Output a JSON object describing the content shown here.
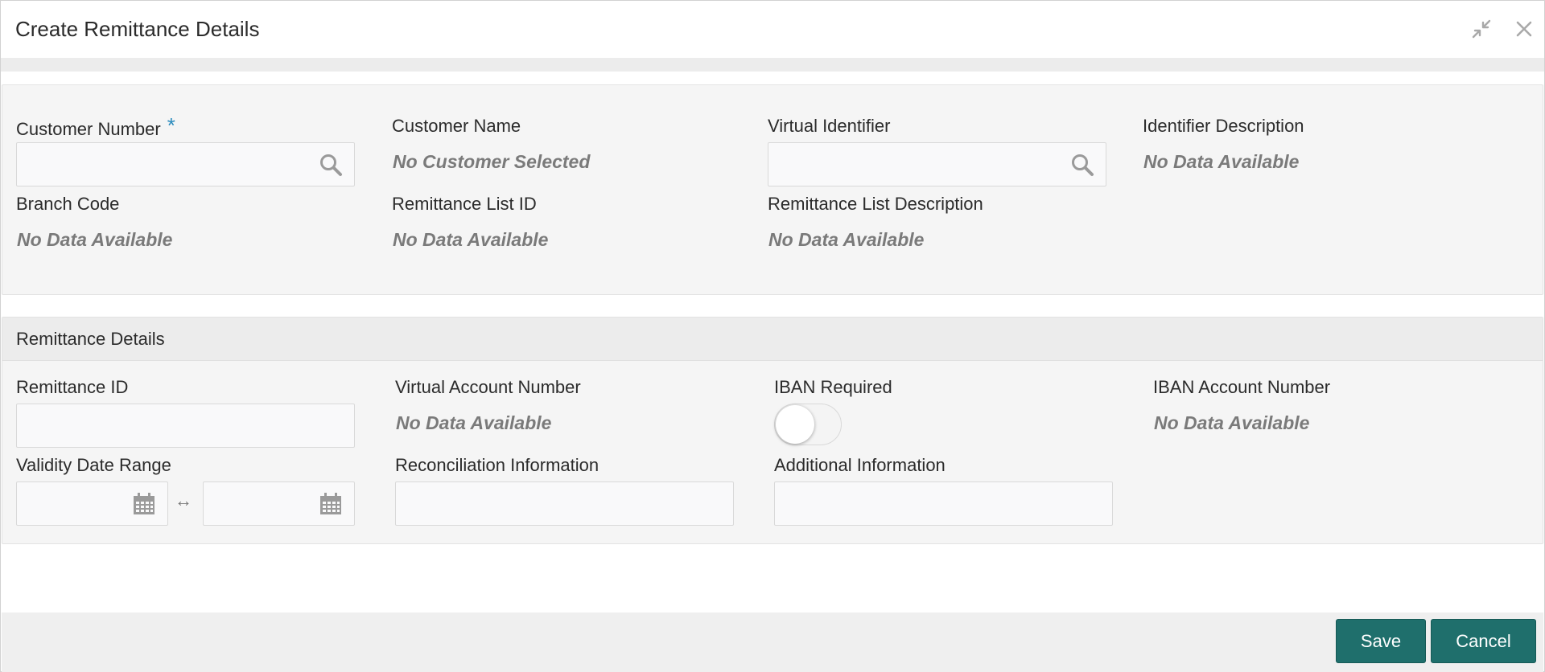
{
  "dialog": {
    "title": "Create Remittance Details"
  },
  "top_panel": {
    "customer_number": {
      "label": "Customer Number",
      "required_mark": "*",
      "value": ""
    },
    "customer_name": {
      "label": "Customer Name",
      "value": "No Customer Selected"
    },
    "virtual_identifier": {
      "label": "Virtual Identifier",
      "value": ""
    },
    "identifier_description": {
      "label": "Identifier Description",
      "value": "No Data Available"
    },
    "branch_code": {
      "label": "Branch Code",
      "value": "No Data Available"
    },
    "remittance_list_id": {
      "label": "Remittance List ID",
      "value": "No Data Available"
    },
    "remittance_list_description": {
      "label": "Remittance List Description",
      "value": "No Data Available"
    }
  },
  "remittance_details": {
    "section_title": "Remittance Details",
    "remittance_id": {
      "label": "Remittance ID",
      "value": ""
    },
    "virtual_account_number": {
      "label": "Virtual Account Number",
      "value": "No Data Available"
    },
    "iban_required": {
      "label": "IBAN Required",
      "on": false
    },
    "iban_account_number": {
      "label": "IBAN Account Number",
      "value": "No Data Available"
    },
    "validity_date_range": {
      "label": "Validity Date Range",
      "from": "",
      "to": "",
      "separator": "↔"
    },
    "reconciliation_information": {
      "label": "Reconciliation Information",
      "value": ""
    },
    "additional_information": {
      "label": "Additional Information",
      "value": ""
    }
  },
  "footer": {
    "save_label": "Save",
    "cancel_label": "Cancel"
  },
  "colors": {
    "primary_button": "#1f6f6c",
    "required_mark": "#2a8bbd",
    "placeholder_value": "#7a7a7a"
  }
}
